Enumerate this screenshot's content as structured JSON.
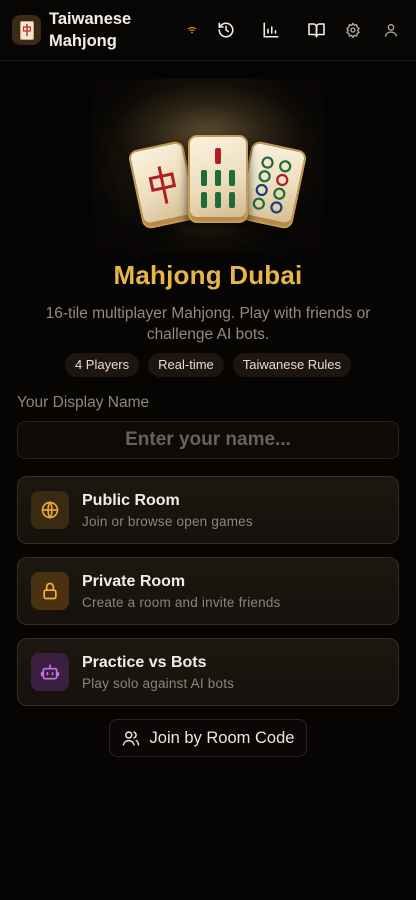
{
  "header": {
    "app_name": "Taiwanese Mahjong",
    "icons": [
      "wifi-icon",
      "history-icon",
      "bar-chart-icon",
      "book-open-icon",
      "settings-icon",
      "user-icon"
    ]
  },
  "hero": {
    "title": "Mahjong Dubai",
    "subtitle": "16-tile multiplayer Mahjong. Play with friends or challenge AI bots.",
    "chips": [
      "4 Players",
      "Real-time",
      "Taiwanese Rules"
    ]
  },
  "name_field": {
    "label": "Your Display Name",
    "placeholder": "Enter your name..."
  },
  "modes": [
    {
      "title": "Public Room",
      "desc": "Join or browse open games",
      "icon": "globe-icon",
      "icon_bg": "#3a2a12",
      "icon_color": "#e6a93b"
    },
    {
      "title": "Private Room",
      "desc": "Create a room and invite friends",
      "icon": "lock-icon",
      "icon_bg": "#4a3210",
      "icon_color": "#f0b23a"
    },
    {
      "title": "Practice vs Bots",
      "desc": "Play solo against AI bots",
      "icon": "bot-icon",
      "icon_bg": "#3a1f40",
      "icon_color": "#c874e0"
    }
  ],
  "join_button": {
    "label": "Join by Room Code",
    "icon": "users-icon"
  },
  "colors": {
    "accent": "#e7b54a",
    "background": "#070404"
  }
}
